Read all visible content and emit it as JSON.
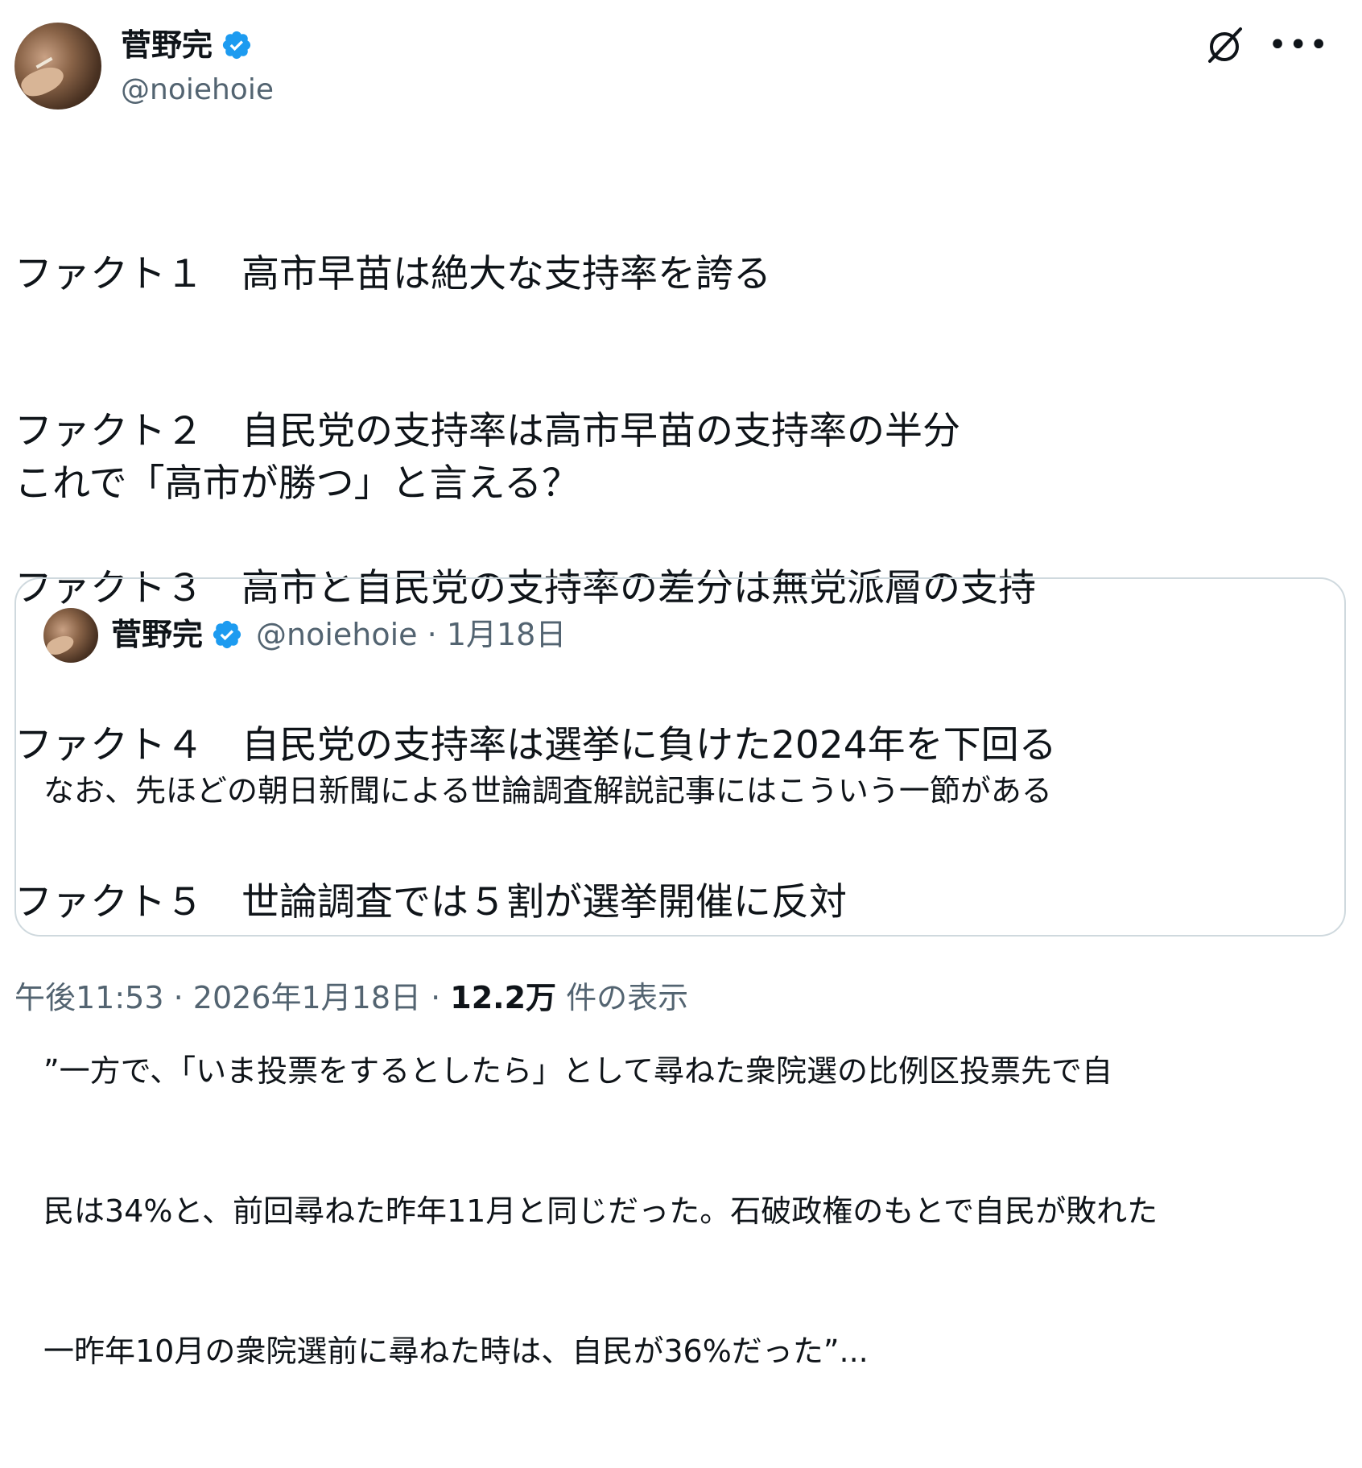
{
  "author": {
    "name": "菅野完",
    "handle": "@noiehoie"
  },
  "colors": {
    "text": "#0f1419",
    "secondary": "#536471",
    "verified": "#1d9bf0",
    "border": "#cfd9de"
  },
  "icons": {
    "verified": "verified-badge-icon",
    "grok": "grok-icon",
    "more": "more-options-icon"
  },
  "tweet": {
    "lines": [
      "ファクト１　高市早苗は絶大な支持率を誇る",
      "ファクト２　自民党の支持率は高市早苗の支持率の半分",
      "ファクト３　高市と自民党の支持率の差分は無党派層の支持",
      "ファクト４　自民党の支持率は選挙に負けた2024年を下回る",
      "ファクト５　世論調査では５割が選挙開催に反対"
    ],
    "question": "これで「高市が勝つ」と言える？"
  },
  "quote": {
    "name": "菅野完",
    "handle": "@noiehoie",
    "date": "1月18日",
    "lines": [
      "なお、先ほどの朝日新聞による世論調査解説記事にはこういう一節がある",
      "",
      "”一方で、「いま投票をするとしたら」として尋ねた衆院選の比例区投票先で自",
      "民は34%と、前回尋ねた昨年11月と同じだった。石破政権のもとで自民が敗れた",
      "一昨年10月の衆院選前に尋ねた時は、自民が36%だった”..."
    ]
  },
  "footer": {
    "time": "午後11:53",
    "date": "2026年1月18日",
    "views": "12.2万",
    "views_label": "件の表示"
  }
}
